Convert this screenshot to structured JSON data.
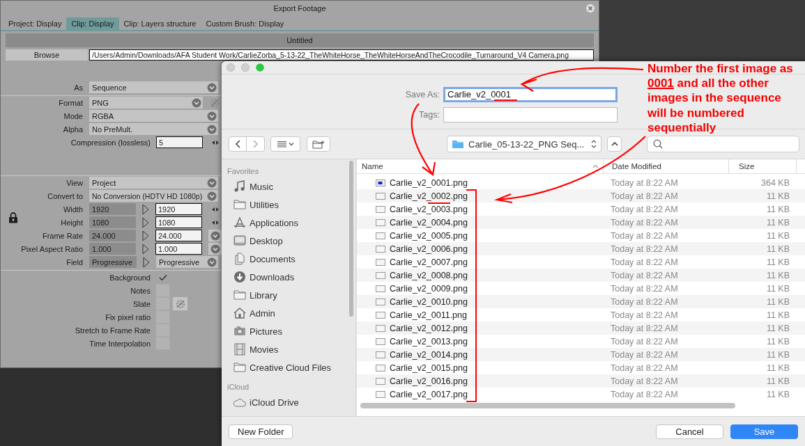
{
  "export_window": {
    "title": "Export Footage",
    "tabs": [
      {
        "label": "Project: Display",
        "selected": false
      },
      {
        "label": "Clip: Display",
        "selected": true
      },
      {
        "label": "Clip: Layers structure",
        "selected": false
      },
      {
        "label": "Custom Brush: Display",
        "selected": false
      }
    ],
    "clip_title": "Untitled",
    "browse_button": "Browse",
    "path": "/Users/Admin/Downloads/AFA Student Work/CarlieZorba_5-13-22_TheWhiteHorse_TheWhiteHorseAndTheCrocodile_Turnaround_V4 Camera.png",
    "output_settings": [
      {
        "kind": "dropdown",
        "label": "As",
        "value": "Sequence"
      }
    ],
    "format_settings": [
      {
        "kind": "dropdown",
        "label": "Format",
        "value": "PNG",
        "gear": true
      },
      {
        "kind": "dropdown",
        "label": "Mode",
        "value": "RGBA"
      },
      {
        "kind": "dropdown",
        "label": "Alpha",
        "value": "No PreMult."
      },
      {
        "kind": "number",
        "label": "Compression (lossless)",
        "value": "5"
      }
    ],
    "view_settings": [
      {
        "kind": "dropdown",
        "label": "View",
        "value": "Project"
      },
      {
        "kind": "dropdown",
        "label": "Convert to",
        "value": "No Conversion (HDTV  HD 1080p)"
      },
      {
        "kind": "spin",
        "label": "Width",
        "source": "1920",
        "value": "1920"
      },
      {
        "kind": "spin",
        "label": "Height",
        "source": "1080",
        "value": "1080"
      },
      {
        "kind": "combo",
        "label": "Frame Rate",
        "source": "24.000",
        "value": "24.000"
      },
      {
        "kind": "combo",
        "label": "Pixel Aspect Ratio",
        "source": "1.000",
        "value": "1.000"
      },
      {
        "kind": "select",
        "label": "Field",
        "source": "Progressive",
        "value": "Progressive"
      }
    ],
    "options": [
      {
        "label": "Background",
        "checked": true
      },
      {
        "label": "Notes",
        "checked": false
      },
      {
        "label": "Slate",
        "checked": false,
        "gear": true
      },
      {
        "label": "Fix pixel ratio",
        "checked": false
      },
      {
        "label": "Stretch to Frame Rate",
        "checked": false
      },
      {
        "label": "Time Interpolation",
        "checked": false
      }
    ]
  },
  "save_dialog": {
    "save_as_label": "Save As:",
    "save_as_value": "Carlie_v2_0001",
    "tags_label": "Tags:",
    "location": "Carlie_05-13-22_PNG Seq...",
    "sidebar": [
      {
        "heading": "Favorites",
        "items": [
          {
            "label": "Music",
            "kind": "music"
          },
          {
            "label": "Utilities",
            "kind": "folder"
          },
          {
            "label": "Applications",
            "kind": "apps"
          },
          {
            "label": "Desktop",
            "kind": "desktop"
          },
          {
            "label": "Documents",
            "kind": "documents"
          },
          {
            "label": "Downloads",
            "kind": "downloads"
          },
          {
            "label": "Library",
            "kind": "folder"
          },
          {
            "label": "Admin",
            "kind": "home"
          },
          {
            "label": "Pictures",
            "kind": "camera"
          },
          {
            "label": "Movies",
            "kind": "film"
          },
          {
            "label": "Creative Cloud Files",
            "kind": "folder"
          }
        ]
      },
      {
        "heading": "iCloud",
        "items": [
          {
            "label": "iCloud Drive",
            "kind": "cloud"
          }
        ]
      }
    ],
    "columns": [
      "Name",
      "Date Modified",
      "Size"
    ],
    "files": [
      {
        "name": "Carlie_v2_0001.png",
        "date": "Today at 8:22 AM",
        "size": "364 KB",
        "kind": "thumbnail"
      },
      {
        "name": "Carlie_v2_0002.png",
        "date": "Today at 8:22 AM",
        "size": "11 KB",
        "kind": "plain"
      },
      {
        "name": "Carlie_v2_0003.png",
        "date": "Today at 8:22 AM",
        "size": "11 KB",
        "kind": "plain"
      },
      {
        "name": "Carlie_v2_0004.png",
        "date": "Today at 8:22 AM",
        "size": "11 KB",
        "kind": "plain"
      },
      {
        "name": "Carlie_v2_0005.png",
        "date": "Today at 8:22 AM",
        "size": "11 KB",
        "kind": "plain"
      },
      {
        "name": "Carlie_v2_0006.png",
        "date": "Today at 8:22 AM",
        "size": "11 KB",
        "kind": "plain"
      },
      {
        "name": "Carlie_v2_0007.png",
        "date": "Today at 8:22 AM",
        "size": "11 KB",
        "kind": "plain"
      },
      {
        "name": "Carlie_v2_0008.png",
        "date": "Today at 8:22 AM",
        "size": "11 KB",
        "kind": "plain"
      },
      {
        "name": "Carlie_v2_0009.png",
        "date": "Today at 8:22 AM",
        "size": "11 KB",
        "kind": "plain"
      },
      {
        "name": "Carlie_v2_0010.png",
        "date": "Today at 8:22 AM",
        "size": "11 KB",
        "kind": "plain"
      },
      {
        "name": "Carlie_v2_0011.png",
        "date": "Today at 8:22 AM",
        "size": "11 KB",
        "kind": "plain"
      },
      {
        "name": "Carlie_v2_0012.png",
        "date": "Today at 8:22 AM",
        "size": "11 KB",
        "kind": "plain"
      },
      {
        "name": "Carlie_v2_0013.png",
        "date": "Today at 8:22 AM",
        "size": "11 KB",
        "kind": "plain"
      },
      {
        "name": "Carlie_v2_0014.png",
        "date": "Today at 8:22 AM",
        "size": "11 KB",
        "kind": "plain"
      },
      {
        "name": "Carlie_v2_0015.png",
        "date": "Today at 8:22 AM",
        "size": "11 KB",
        "kind": "plain"
      },
      {
        "name": "Carlie_v2_0016.png",
        "date": "Today at 8:22 AM",
        "size": "11 KB",
        "kind": "plain"
      },
      {
        "name": "Carlie_v2_0017.png",
        "date": "Today at 8:22 AM",
        "size": "11 KB",
        "kind": "plain"
      }
    ],
    "left_buttons": [
      {
        "label": "New Folder",
        "default": false
      }
    ],
    "right_buttons": [
      {
        "label": "Cancel",
        "default": false
      },
      {
        "label": "Save",
        "default": true
      }
    ]
  },
  "annotation": {
    "parts": [
      {
        "text": "Number the first image as ",
        "underlined": false
      },
      {
        "text": "0001",
        "underlined": true
      },
      {
        "text": " and all the other images in the sequence will be numbered sequentially",
        "underlined": false
      }
    ]
  }
}
